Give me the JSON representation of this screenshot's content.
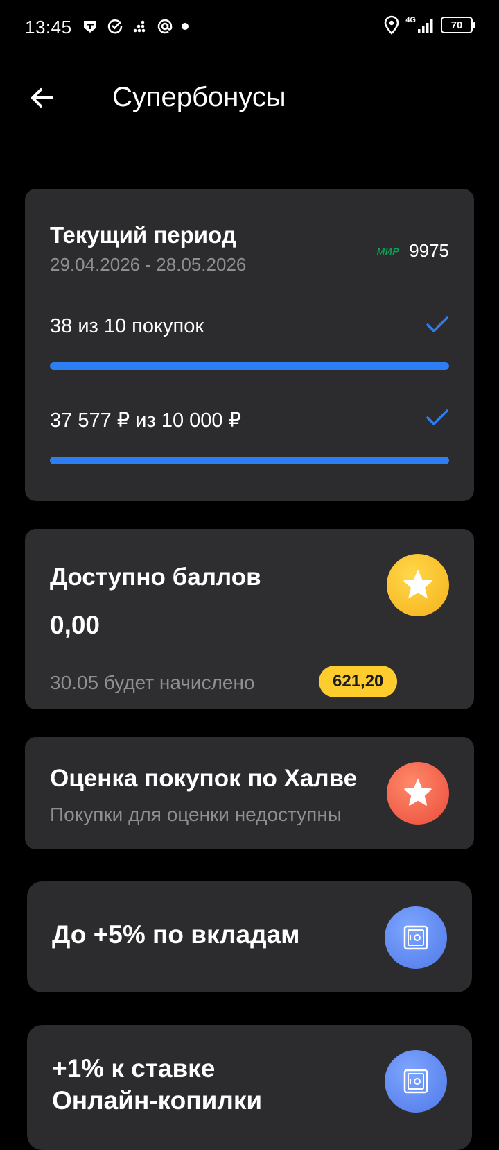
{
  "status_bar": {
    "time": "13:45",
    "network": "4G",
    "battery": "70"
  },
  "header": {
    "title": "Супербонусы"
  },
  "period": {
    "title": "Текущий период",
    "dates": "29.04.2026 - 28.05.2026",
    "card_logo": "МИР",
    "card_last4": "9975",
    "purchases_label": "38 из 10 покупок",
    "purchases_progress": 1.0,
    "amount_label": "37 577 ₽ из 10 000 ₽",
    "amount_progress": 1.0
  },
  "points": {
    "title": "Доступно баллов",
    "value": "0,00",
    "accrual_text": "30.05 будет начислено",
    "accrual_amount": "621,20"
  },
  "rating": {
    "title": "Оценка покупок по Халве",
    "subtitle": "Покупки для оценки недоступны"
  },
  "deposit": {
    "title": "До +5% по вкладам"
  },
  "savings": {
    "title_line1": "+1% к ставке",
    "title_line2": "Онлайн-копилки"
  },
  "colors": {
    "background": "#000000",
    "card": "#2c2c2e",
    "accent_blue": "#2d7ef5",
    "badge_yellow": "#ffcc2e",
    "muted_text": "#8e8e93"
  },
  "icons": {
    "back": "arrow-left-icon",
    "check": "check-icon",
    "star": "star-icon",
    "safe": "safe-icon"
  }
}
